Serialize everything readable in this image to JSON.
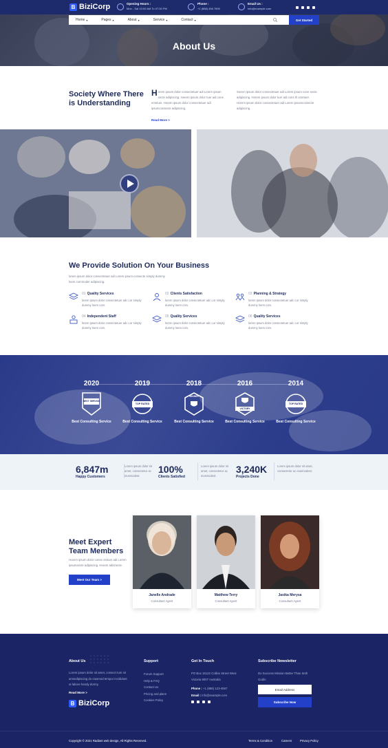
{
  "brand": {
    "logo_letter": "B",
    "name": "BiziCorp"
  },
  "topbar": {
    "hours": {
      "label": "Opening Hours :",
      "value": "Mon - Sat 10:00 AM To 07:30 PM"
    },
    "phone": {
      "label": "Phone :",
      "value": "+1 (888) 456 7890"
    },
    "email": {
      "label": "Email Us :",
      "value": "info@example.com"
    },
    "social_icons": [
      "facebook-icon",
      "twitter-icon",
      "youtube-icon",
      "instagram-icon"
    ]
  },
  "nav": {
    "items": [
      "Home",
      "Pages",
      "About",
      "Service",
      "Contact"
    ],
    "cta": "Get Started"
  },
  "hero": {
    "title": "About Us"
  },
  "society": {
    "heading": "Society Where There is Understanding",
    "col1_dropcap": "H",
    "col1": "orem ipsum dolor consectetuer adi Lorem ipsum secte adipiscing. Horem ipsum dolor tuer adi cons ectetuer. Horem ipsum dolor consectetuer adi ipsumconsecte adipiscing.",
    "col2": "Sorem ipsum dolor consectetuer adi Lorem ipsum conn secte adipiscing. Horem ipsum dolor tuer adi cons Ih ectetuer. Horem ipsum dolor consectetuer adi Lorem ipsumconsecte adipiscing.",
    "read_more": "Read More >"
  },
  "solutions": {
    "heading": "We Provide Solution On Your Business",
    "intro": "lorem ipsum dolor consectetuer adi Lorem ipsum consecte simply dummy loem commoder adipiscing.",
    "items": [
      {
        "num": "01",
        "title": "Quality Services",
        "desc": "lorem ipsum dolor consectetuer adc Lor simply dummy loem com.",
        "icon": "layers-icon"
      },
      {
        "num": "02",
        "title": "Clients Satisfaction",
        "desc": "lorem ipsum dolor consectetuer adc Lor simply dummy loem com.",
        "icon": "user-icon"
      },
      {
        "num": "03",
        "title": "Planning & Strategy",
        "desc": "lorem ipsum dolor consectetuer adc Lor simply dummy loem com.",
        "icon": "team-icon"
      },
      {
        "num": "04",
        "title": "Independent Staff",
        "desc": "lorem ipsum dolor consectetuer adc Lor simply dummy loem com.",
        "icon": "staff-icon"
      },
      {
        "num": "05",
        "title": "Quality Services",
        "desc": "lorem ipsum dolor consectetuer adc Lor simply dummy loem com.",
        "icon": "layers-icon"
      },
      {
        "num": "06",
        "title": "Quality Services",
        "desc": "lorem ipsum dolor consectetuer adc Lor simply dummy loem com.",
        "icon": "layers-icon"
      }
    ]
  },
  "awards": [
    {
      "year": "2020",
      "badge": "BEST SERVICE",
      "label": "Best Consulting Service"
    },
    {
      "year": "2019",
      "badge": "TOP RATED",
      "label": "Best Consulting Service"
    },
    {
      "year": "2018",
      "badge": "WINNER",
      "label": "Best Consulting Service"
    },
    {
      "year": "2016",
      "badge": "VICTORY",
      "label": "Best Consulting Service"
    },
    {
      "year": "2014",
      "badge": "TOP RATED",
      "label": "Best Consulting Service"
    }
  ],
  "stats": {
    "items": [
      {
        "num": "6,847m",
        "label": "Happy Customers",
        "desc": "Lorem ipsum dolor sit amet, consectetur ac eiusmodest."
      },
      {
        "num": "100%",
        "label": "Clients Satisfied",
        "desc": "Lorem ipsum dolor sit amet, consectetur ac eiusmodest."
      },
      {
        "num": "3,240K",
        "label": "Projects Done",
        "desc": "Lorem ipsum dolor sit amet, consectetur ac eiusmodest."
      }
    ]
  },
  "team": {
    "heading": "Meet Expert Team Members",
    "desc": "Horem ipsum dolor conse ctetuer adi Lorem ipsumsecte adipiscing. Horem adisnecte.",
    "button": "Meet Our Team >",
    "members": [
      {
        "name": "Janelle Andrade",
        "role": "Consultant Agent"
      },
      {
        "name": "Matthew Terry",
        "role": "Consultant Agent"
      },
      {
        "name": "Jasika Merysa",
        "role": "Consultant Agent"
      }
    ]
  },
  "footer": {
    "about": {
      "heading": "About Us",
      "text": "Lorem ipsum dolor sit amet, consect tum sit amsedipiscing do eiusmod tempor incididunt ut labore handy dormy.",
      "read_more": "Read More >"
    },
    "support": {
      "heading": "Support",
      "links": [
        "Forum Support",
        "Help & FAQ",
        "Contact Us",
        "Pricing and plans",
        "Cookies Policy"
      ]
    },
    "contact": {
      "heading": "Get In Touch",
      "address": "PO Box 16122 Collins Street West Victoria 8007 Australia",
      "phone_label": "Phone :",
      "phone": "+1 (888) 123-4567",
      "email_label": "Email :",
      "email": "info@example.com"
    },
    "newsletter": {
      "heading": "Subscribe Newsletter",
      "text": "Do Success Mission Better Than Seth Godin",
      "placeholder": "Email Address",
      "button": "Subscribe Now"
    },
    "copyright": "Copyright © 2021 Radiant web design, All Rights Reserved.",
    "bottom_links": [
      "Terms & Condition",
      "Careers",
      "Privacy Policy"
    ]
  }
}
